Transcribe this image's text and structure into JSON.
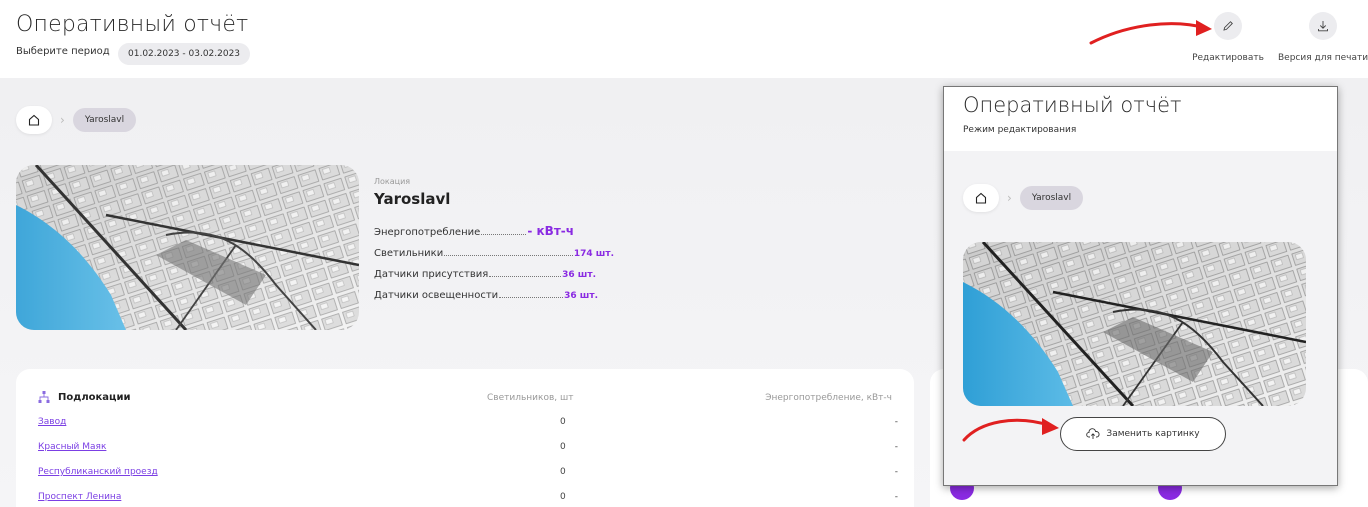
{
  "header": {
    "title": "Оперативный отчёт",
    "period_label": "Выберите период",
    "period_value": "01.02.2023 - 03.02.2023",
    "tools": [
      {
        "label": "Редактировать",
        "icon": "pencil-icon"
      },
      {
        "label": "Версия для печати",
        "icon": "download-icon"
      }
    ]
  },
  "breadcrumb": {
    "home_icon": "home-icon",
    "current": "Yaroslavl"
  },
  "location": {
    "caption": "Локация",
    "name": "Yaroslavl",
    "stats": [
      {
        "label": "Энергопотребление",
        "value": "- кВт-ч"
      },
      {
        "label": "Светильники",
        "value": "174 шт."
      },
      {
        "label": "Датчики присутствия",
        "value": "36 шт."
      },
      {
        "label": "Датчики освещенности",
        "value": "36 шт."
      }
    ]
  },
  "sublocations": {
    "title": "Подлокации",
    "columns": [
      "Светильников, шт",
      "Энергопотребление, кВт-ч"
    ],
    "rows": [
      {
        "name": "Завод",
        "lamps": "0",
        "energy": "-"
      },
      {
        "name": "Красный Маяк",
        "lamps": "0",
        "energy": "-"
      },
      {
        "name": "Республиканский проезд",
        "lamps": "0",
        "energy": "-"
      },
      {
        "name": "Проспект Ленина",
        "lamps": "0",
        "energy": "-"
      }
    ]
  },
  "edit_panel": {
    "title": "Оперативный отчёт",
    "subtitle": "Режим редактирования",
    "breadcrumb_current": "Yaroslavl",
    "replace_button": "Заменить картинку"
  },
  "colors": {
    "accent": "#8a2be2",
    "link": "#7b3fe4",
    "annotation_arrow": "#e02020",
    "water": "#3aa6d8"
  }
}
